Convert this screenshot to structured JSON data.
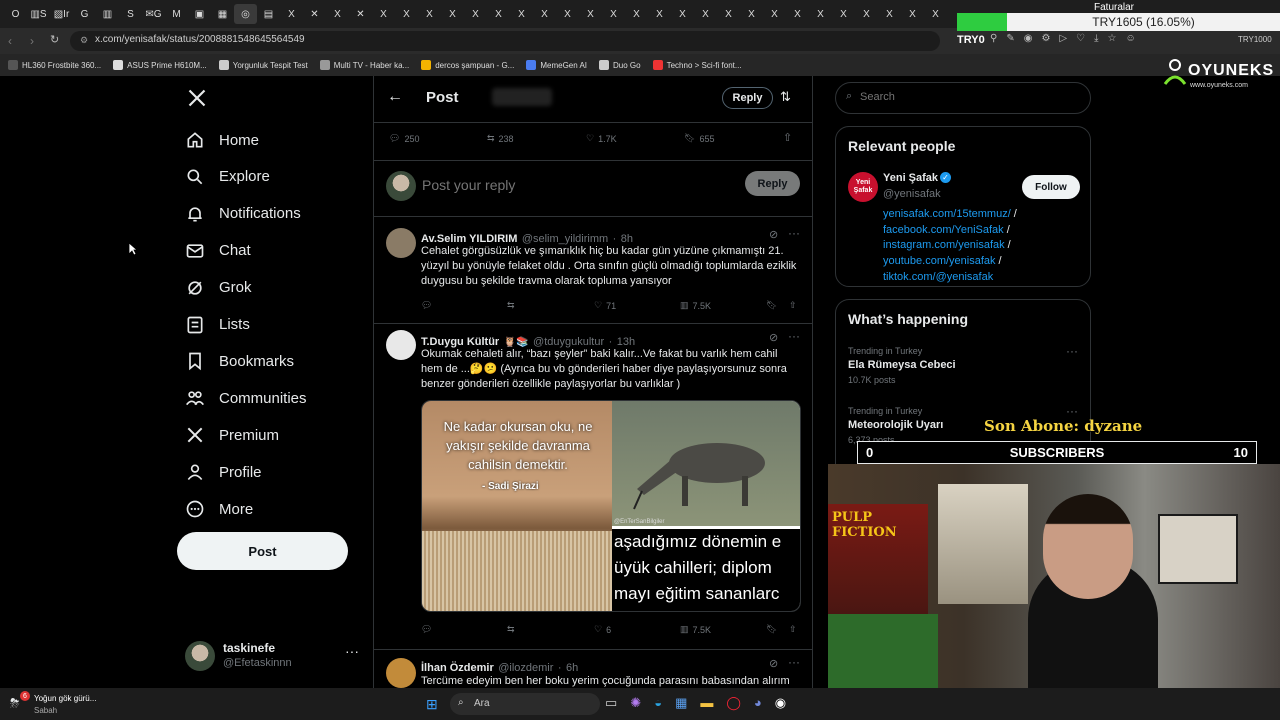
{
  "browser": {
    "url": "x.com/yenisafak/status/2008881548645564549",
    "bookmarks": [
      {
        "label": "HL360 Frostbite 360...",
        "color": "#555"
      },
      {
        "label": "ASUS Prime H610M...",
        "color": "#ddd"
      },
      {
        "label": "Yorgunluk Tespit Test",
        "color": "#ccc"
      },
      {
        "label": "Multi TV - Haber ka...",
        "color": "#999"
      },
      {
        "label": "dercos şampuan - G...",
        "color": "#f4b400"
      },
      {
        "label": "MemeGen AI",
        "color": "#4a7cf0"
      },
      {
        "label": "Duo Go",
        "color": "#ccc"
      },
      {
        "label": "Techno > Sci-fi font...",
        "color": "#e33"
      }
    ],
    "extension_currency": "TRY0",
    "extension_currency_right": "TRY1000",
    "faturalar": "Faturalar",
    "price_badge": "TRY1605 (16.05%)"
  },
  "sidebar": {
    "nav": [
      {
        "label": "Home",
        "icon": "home-icon"
      },
      {
        "label": "Explore",
        "icon": "search-icon"
      },
      {
        "label": "Notifications",
        "icon": "bell-icon"
      },
      {
        "label": "Chat",
        "icon": "mail-icon"
      },
      {
        "label": "Grok",
        "icon": "grok-icon"
      },
      {
        "label": "Lists",
        "icon": "list-icon"
      },
      {
        "label": "Bookmarks",
        "icon": "bookmark-icon"
      },
      {
        "label": "Communities",
        "icon": "people-icon"
      },
      {
        "label": "Premium",
        "icon": "x-logo-icon"
      },
      {
        "label": "Profile",
        "icon": "person-icon"
      },
      {
        "label": "More",
        "icon": "more-circle-icon"
      }
    ],
    "post_button": "Post",
    "account": {
      "name": "taskinefe",
      "handle": "@Efetaskinnn"
    }
  },
  "header": {
    "title": "Post",
    "reply_label": "Reply"
  },
  "post_stats": {
    "replies": "250",
    "reposts": "238",
    "likes": "1.7K",
    "bookmarks": "655"
  },
  "composer": {
    "placeholder": "Post your reply",
    "reply_button": "Reply"
  },
  "replies": [
    {
      "name": "Av.Selim YILDIRIM",
      "handle": "@selim_yildirimm",
      "time": "8h",
      "text": "Cehalet görgüsüzlük ve şımarıklık hiç bu kadar gün yüzüne çıkmamıştı 21. yüzyıl bu yönüyle felaket oldu . Orta sınıfın güçlü olmadığı toplumlarda eziklik duygusu bu şekilde travma olarak topluma yansıyor",
      "likes": "71",
      "views": "7.5K"
    },
    {
      "name": "T.Duygu Kültür",
      "handle": "@tduygukultur",
      "time": "13h",
      "text": "Okumak cehaleti alır, “bazı şeyler” baki kalır...Ve fakat bu varlık hem cahil hem de ...🤔😕 (Ayrıca bu vb gönderileri haber diye paylaşıyorsunuz sonra benzer gönderileri özellikle paylaşıyorlar bu varlıklar )",
      "likes": "6",
      "views": "7.5K",
      "image_left_text": "Ne kadar okursan oku, ne yakışır şekilde davranma cahilsin demektir.",
      "image_left_author": "- Sadi Şirazi",
      "image_right_watermark": "@EnTerSanBilgiler",
      "image_right_text": "aşadığımız dönemin e üyük cahilleri; diplom mayı eğitim sananlarc"
    },
    {
      "name": "İlhan Özdemir",
      "handle": "@ilozdemir",
      "time": "6h",
      "text": "Tercüme edeyim ben her boku yerim çocuğunda parasını babasından alırım"
    }
  ],
  "right": {
    "search_placeholder": "Search",
    "relevant_title": "Relevant people",
    "person": {
      "name": "Yeni Şafak",
      "handle": "@yenisafak",
      "follow": "Follow",
      "links": [
        "yenisafak.com/15temmuz/",
        "facebook.com/YeniSafak",
        "instagram.com/yenisafak",
        "youtube.com/yenisafak",
        "tiktok.com/@yenisafak"
      ]
    },
    "happening_title": "What’s happening",
    "trends": [
      {
        "context": "Trending in Turkey",
        "title": "Ela Rümeysa Cebeci",
        "posts": "10.7K posts"
      },
      {
        "context": "Trending in Turkey",
        "title": "Meteorolojik Uyarı",
        "posts": "6,373 posts"
      }
    ]
  },
  "stream_overlay": {
    "brand": "OYUNEKS",
    "brand_url": "www.oyuneks.com",
    "last_sub": "Son Abone: dyzane",
    "sub_left": "0",
    "sub_label": "SUBSCRIBERS",
    "sub_right": "10",
    "poster": "PULP FICTION"
  },
  "taskbar": {
    "weather": "Yoğun gök gürü...",
    "weather_sub": "Sabah",
    "weather_badge": "6",
    "search": "Ara"
  }
}
